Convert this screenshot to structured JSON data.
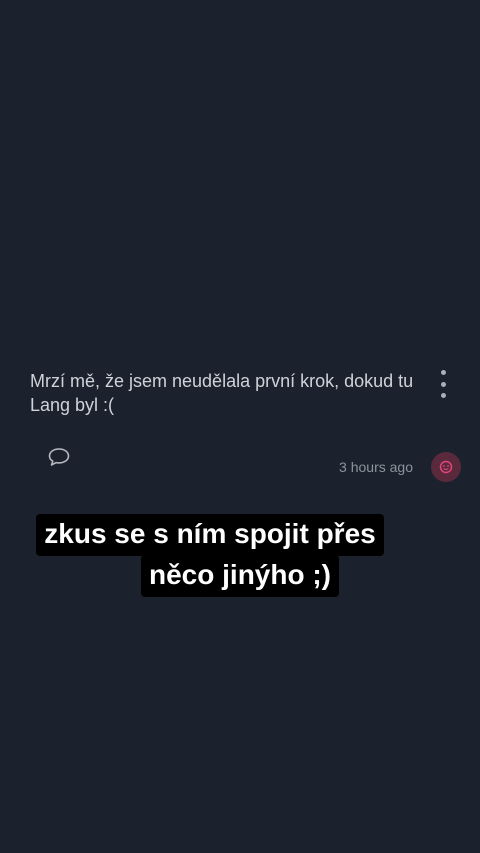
{
  "post": {
    "text": "Mrzí mě, že jsem neudělala první krok, dokud tu Lang byl :(",
    "timestamp": "3 hours ago"
  },
  "icons": {
    "more": "more-vertical-icon",
    "comment": "comment-bubble-icon",
    "reaction": "reaction-icon"
  },
  "caption": {
    "line1": "zkus se s ním spojit přes",
    "line2": "něco jinýho ;)"
  },
  "colors": {
    "background": "#1c222d",
    "reaction_accent": "#e0467c",
    "caption_bg": "#000000",
    "caption_text": "#ffffff"
  }
}
